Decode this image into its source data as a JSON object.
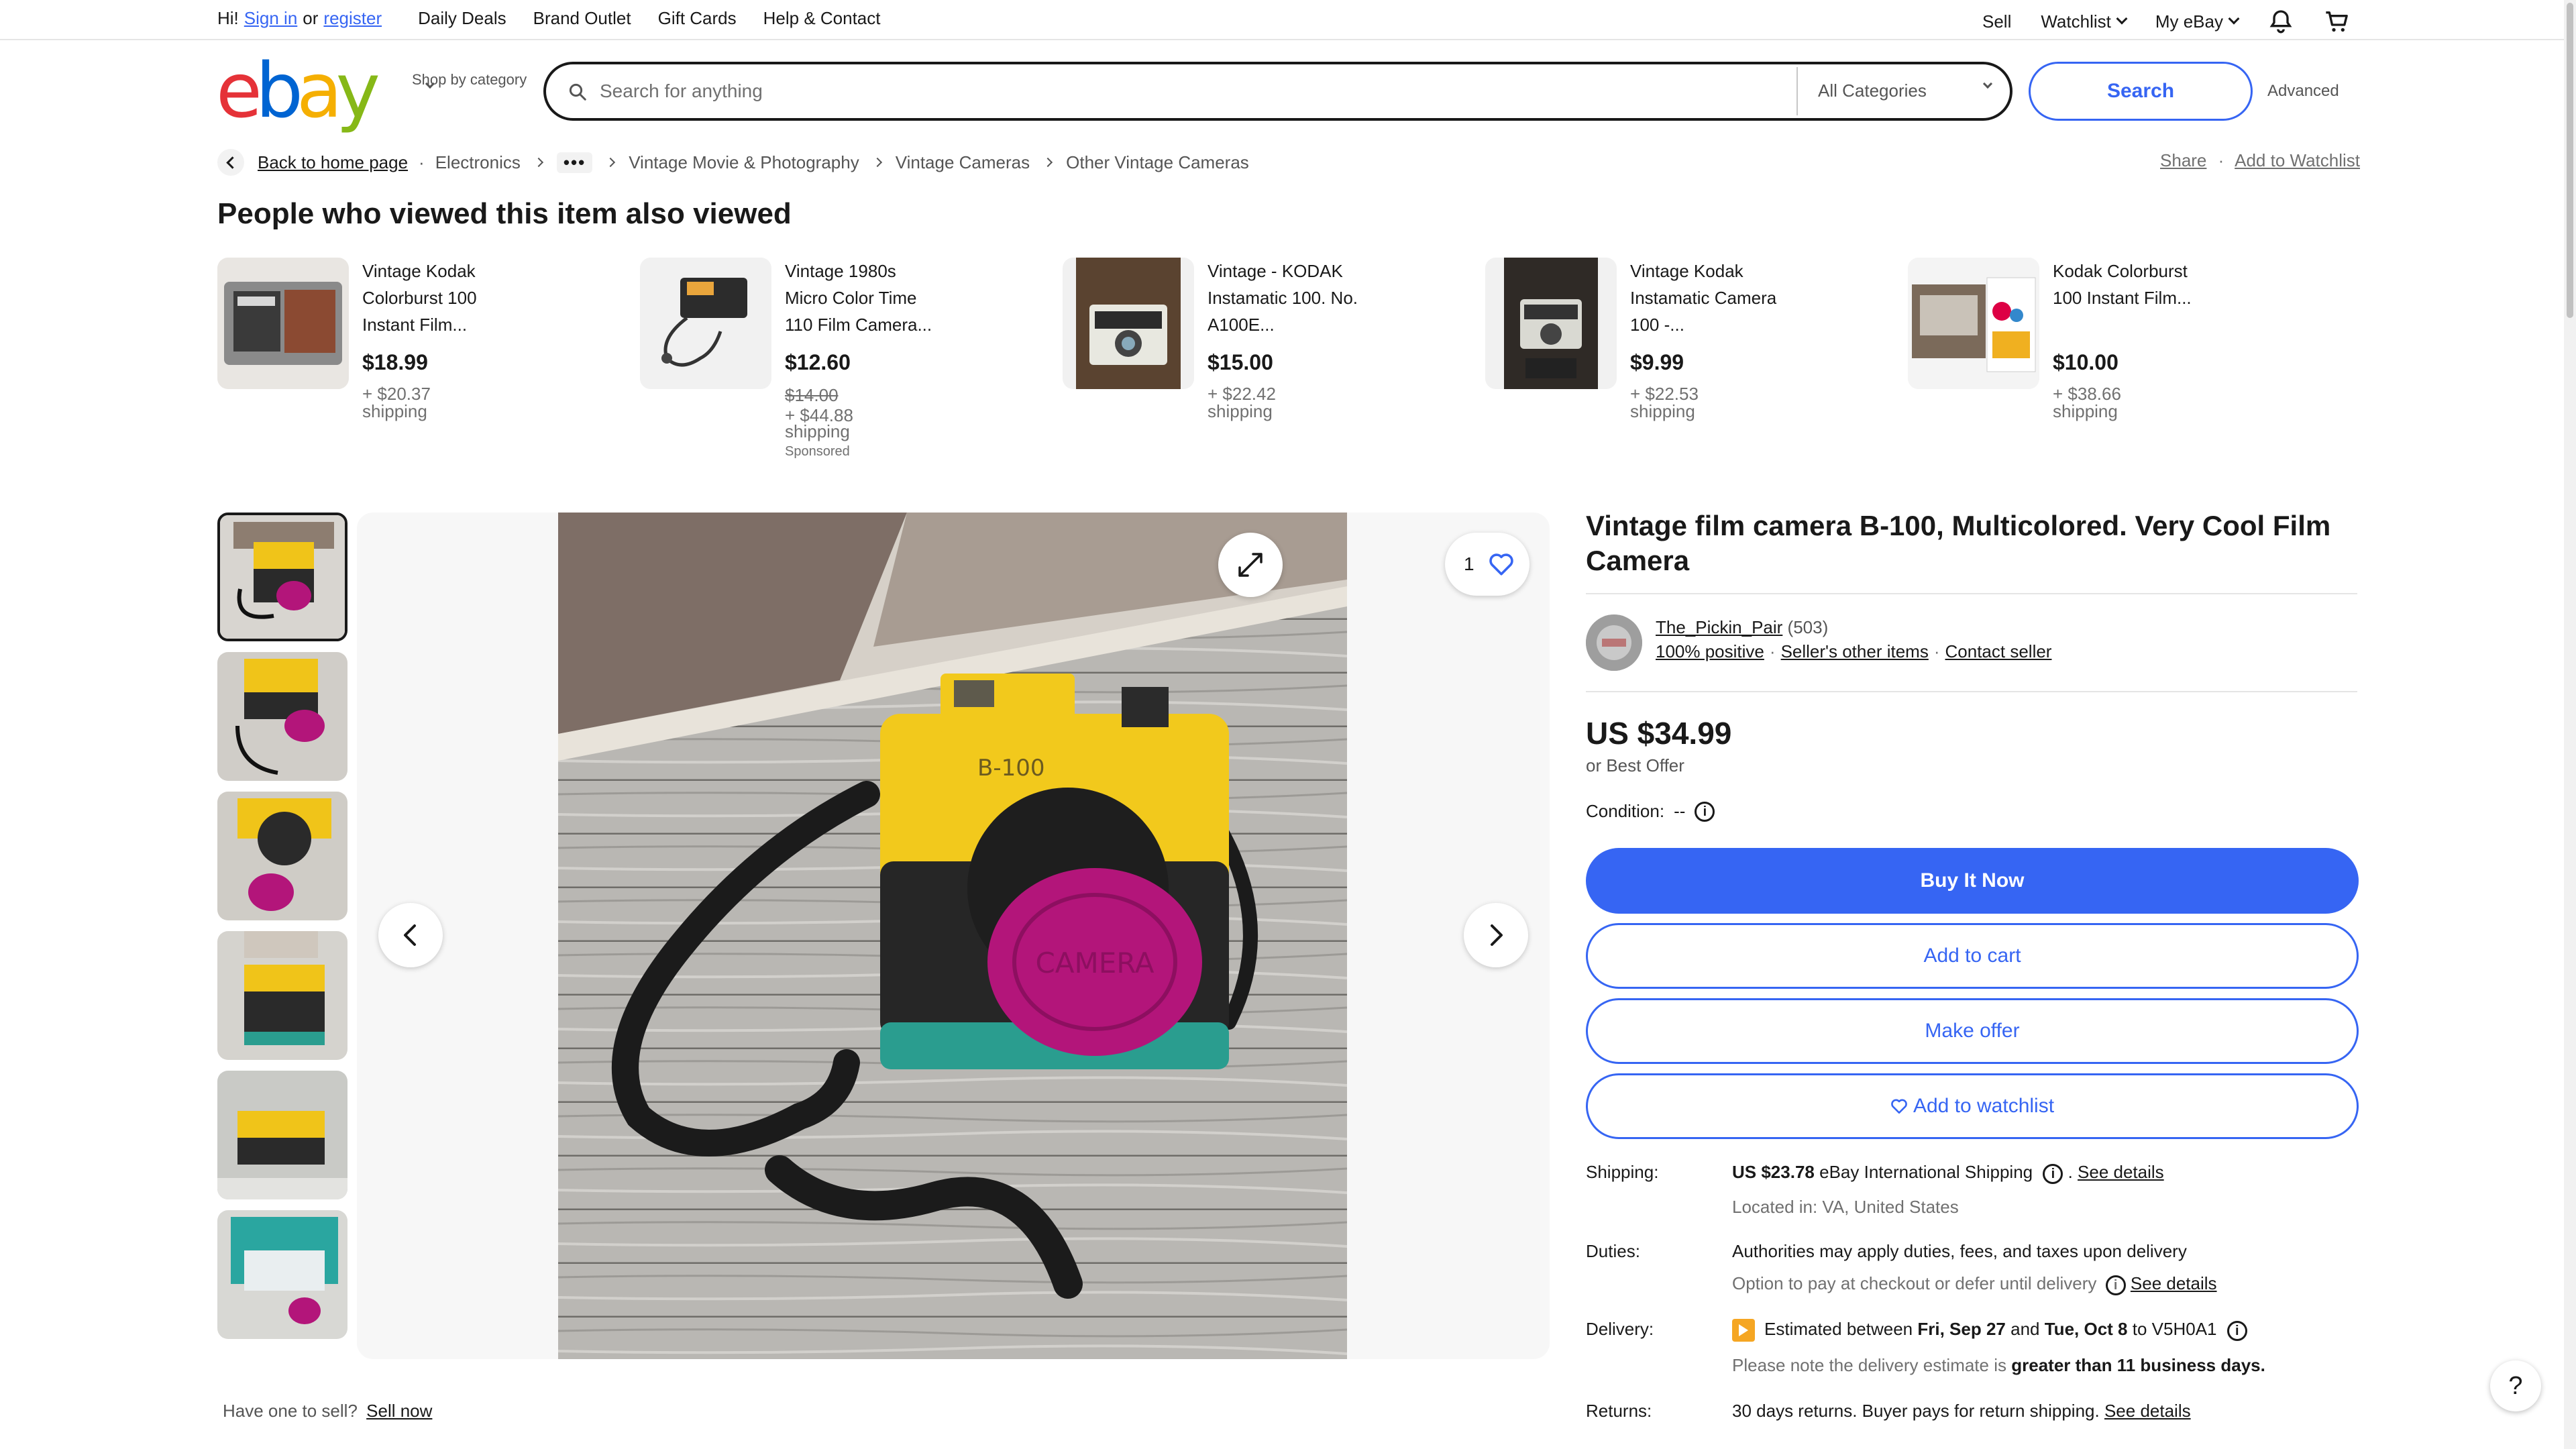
{
  "topnav": {
    "greeting_start": "Hi!",
    "sign_in": "Sign in",
    "or": "or",
    "register": "register",
    "items": [
      "Daily Deals",
      "Brand Outlet",
      "Gift Cards",
      "Help & Contact"
    ],
    "sell": "Sell",
    "watchlist": "Watchlist",
    "myebay": "My eBay"
  },
  "header": {
    "logo_letters": [
      "e",
      "b",
      "a",
      "y"
    ],
    "shop_by_category": "Shop by category",
    "search_placeholder": "Search for anything",
    "category_select": "All Categories",
    "search_button": "Search",
    "advanced": "Advanced"
  },
  "breadcrumb": {
    "back": "Back to home page",
    "items": [
      "Electronics",
      "Vintage Movie & Photography",
      "Vintage Cameras",
      "Other Vintage Cameras"
    ],
    "more": "•••",
    "share": "Share",
    "add_to_watchlist": "Add to Watchlist"
  },
  "also_viewed": {
    "heading": "People who viewed this item also viewed",
    "items": [
      {
        "title": "Vintage Kodak Colorburst 100 Instant Film...",
        "price": "$18.99",
        "old_price": "",
        "shipping1": "+ $20.37",
        "shipping2": "shipping",
        "sponsored": ""
      },
      {
        "title": "Vintage 1980s Micro Color Time 110 Film Camera...",
        "price": "$12.60",
        "old_price": "$14.00",
        "shipping1": "+ $44.88",
        "shipping2": "shipping",
        "sponsored": "Sponsored"
      },
      {
        "title": "Vintage - KODAK Instamatic 100. No. A100E...",
        "price": "$15.00",
        "old_price": "",
        "shipping1": "+ $22.42",
        "shipping2": "shipping",
        "sponsored": ""
      },
      {
        "title": "Vintage Kodak Instamatic Camera 100 -...",
        "price": "$9.99",
        "old_price": "",
        "shipping1": "+ $22.53",
        "shipping2": "shipping",
        "sponsored": ""
      },
      {
        "title": "Kodak Colorburst 100 Instant Film...",
        "price": "$10.00",
        "old_price": "",
        "shipping1": "+ $38.66",
        "shipping2": "shipping",
        "sponsored": ""
      }
    ]
  },
  "gallery": {
    "watch_count": "1",
    "camera_label": "B-100",
    "cap_label": "CAMERA",
    "sell_prompt": "Have one to sell?",
    "sell_now": "Sell now"
  },
  "product": {
    "title": "Vintage film camera B-100, Multicolored. Very Cool Film Camera",
    "seller_name": "The_Pickin_Pair",
    "seller_count": "(503)",
    "positive": "100% positive",
    "other_items": "Seller's other items",
    "contact": "Contact seller",
    "price": "US $34.99",
    "best_offer": "or Best Offer",
    "condition_label": "Condition:",
    "condition_value": "--",
    "buy_now": "Buy It Now",
    "add_cart": "Add to cart",
    "make_offer": "Make offer",
    "add_watchlist": "Add to watchlist",
    "shipping_label": "Shipping:",
    "shipping_value": "US $23.78",
    "shipping_method": "eBay International Shipping",
    "see_details": "See details",
    "located": "Located in: VA, United States",
    "duties_label": "Duties:",
    "duties_line1": "Authorities may apply duties, fees, and taxes upon delivery",
    "duties_line2": "Option to pay at checkout or defer until delivery",
    "delivery_label": "Delivery:",
    "delivery_pre": "Estimated between",
    "delivery_from": "Fri, Sep 27",
    "delivery_and": "and",
    "delivery_to": "Tue, Oct 8",
    "delivery_post": "to V5H0A1",
    "delivery_note_pre": "Please note the delivery estimate is",
    "delivery_note_bold": "greater than 11 business days.",
    "returns_label": "Returns:",
    "returns_value": "30 days returns. Buyer pays for return shipping."
  },
  "help": "?"
}
